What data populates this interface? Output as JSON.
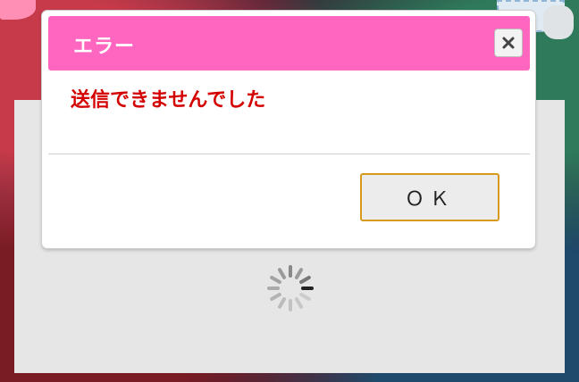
{
  "dialog": {
    "title": "エラー",
    "message": "送信できませんでした",
    "ok_label": "ＯＫ",
    "close_icon": "close-icon"
  },
  "colors": {
    "header": "#ff66c0",
    "message": "#d40000",
    "ok_border": "#d79a1d",
    "loading_panel": "#e6e6e6"
  },
  "loading": {
    "icon": "spinner-icon"
  }
}
